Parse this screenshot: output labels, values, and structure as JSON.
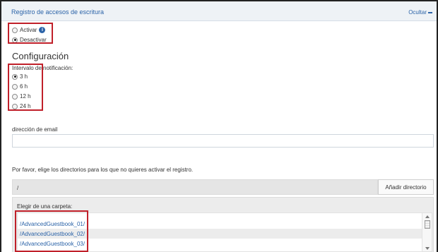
{
  "header": {
    "title": "Registro de accesos de escritura",
    "toggle_label": "Ocultar"
  },
  "activation": {
    "options": [
      {
        "label": "Activar",
        "selected": false,
        "has_info_icon": true
      },
      {
        "label": "Desactivar",
        "selected": true
      }
    ]
  },
  "config": {
    "title": "Configuración",
    "interval_label": "Intervalo de notificación:",
    "interval_options": [
      {
        "label": "3 h",
        "selected": true
      },
      {
        "label": "6 h",
        "selected": false
      },
      {
        "label": "12 h",
        "selected": false
      },
      {
        "label": "24 h",
        "selected": false
      }
    ],
    "email_label": "dirección de email",
    "email_value": ""
  },
  "directories": {
    "instructions": "Por favor, elige los directorios para los que no quieres activar el registro.",
    "current_path": "/",
    "add_button_label": "Añadir directorio",
    "choose_folder_label": "Elegir de una carpeta:",
    "folders": [
      "/AdvancedGuestbook_01/",
      "/AdvancedGuestbook_02/",
      "/AdvancedGuestbook_03/"
    ]
  },
  "colors": {
    "link": "#2b63a8",
    "highlight_box": "#c0202a",
    "header_bg": "#eef2f6"
  }
}
